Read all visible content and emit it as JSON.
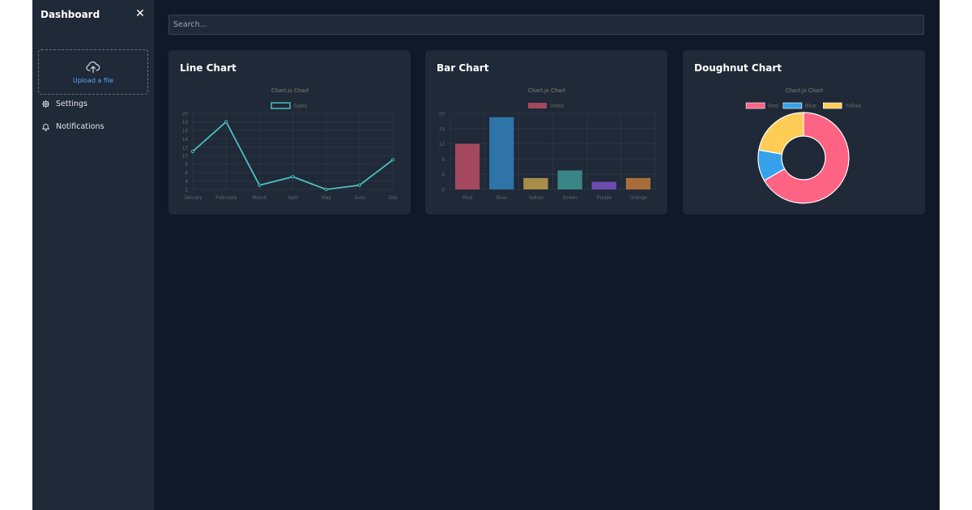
{
  "sidebar": {
    "title": "Dashboard",
    "close_icon": "close-icon",
    "upload_label": "Upload a file",
    "items": [
      {
        "label": "Settings",
        "icon": "gear-icon"
      },
      {
        "label": "Notifications",
        "icon": "bell-icon"
      }
    ]
  },
  "search": {
    "placeholder": "Search..."
  },
  "cards": [
    {
      "title": "Line Chart"
    },
    {
      "title": "Bar Chart"
    },
    {
      "title": "Doughnut Chart"
    }
  ],
  "chart_data": [
    {
      "type": "line",
      "title": "Chart.js Chart",
      "categories": [
        "January",
        "February",
        "March",
        "April",
        "May",
        "June",
        "July"
      ],
      "series": [
        {
          "name": "Sales",
          "values": [
            11,
            18,
            3,
            5,
            2,
            3,
            9
          ],
          "color": "#4bc0c0"
        }
      ],
      "yticks": [
        "20",
        "18",
        "16",
        "14",
        "12",
        "10",
        "8",
        "6",
        "4",
        "2"
      ],
      "ylim": [
        2,
        20
      ],
      "legend": "top",
      "grid": true
    },
    {
      "type": "bar",
      "title": "Chart.js Chart",
      "categories": [
        "Red",
        "Blue",
        "Yellow",
        "Green",
        "Purple",
        "Orange"
      ],
      "series": [
        {
          "name": "Votes",
          "values": [
            12,
            19,
            3,
            5,
            2,
            3
          ]
        }
      ],
      "colors": [
        "#a3485f",
        "#2e74a8",
        "#a88c48",
        "#3a8585",
        "#6c4bb0",
        "#a86d3a"
      ],
      "legend_color": "#a3485f",
      "yticks": [
        "20",
        "16",
        "12",
        "8",
        "4",
        "0"
      ],
      "ylim": [
        0,
        20
      ],
      "legend": "top",
      "grid": true
    },
    {
      "type": "pie",
      "title": "Chart.js Chart",
      "categories": [
        "Red",
        "Blue",
        "Yellow"
      ],
      "values": [
        300,
        50,
        100
      ],
      "colors": [
        "#ff6384",
        "#36a2eb",
        "#ffcd56"
      ],
      "legend": "top"
    }
  ]
}
